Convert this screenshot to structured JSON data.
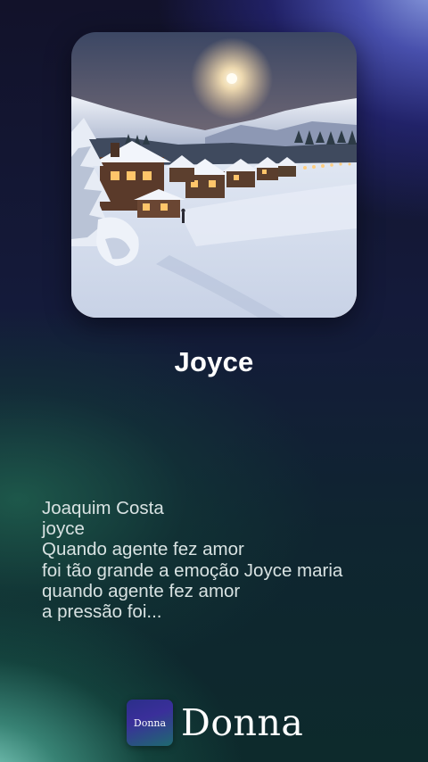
{
  "song": {
    "title": "Joyce",
    "cover_icon": "winter-village-artwork"
  },
  "lyrics": {
    "lines": [
      "Joaquim Costa",
      "joyce",
      "Quando agente fez amor",
      "foi tão grande a emoção Joyce maria",
      "quando agente fez amor",
      "a pressão foi..."
    ]
  },
  "brand": {
    "badge_text": "Donna",
    "name": "Donna",
    "icon": "donna-logo-icon"
  },
  "colors": {
    "accent_top_right": "#8f9ff0",
    "accent_bottom_left": "#8ee0d0",
    "background": "#12152e",
    "lyrics_text": "#d8e2e2"
  }
}
